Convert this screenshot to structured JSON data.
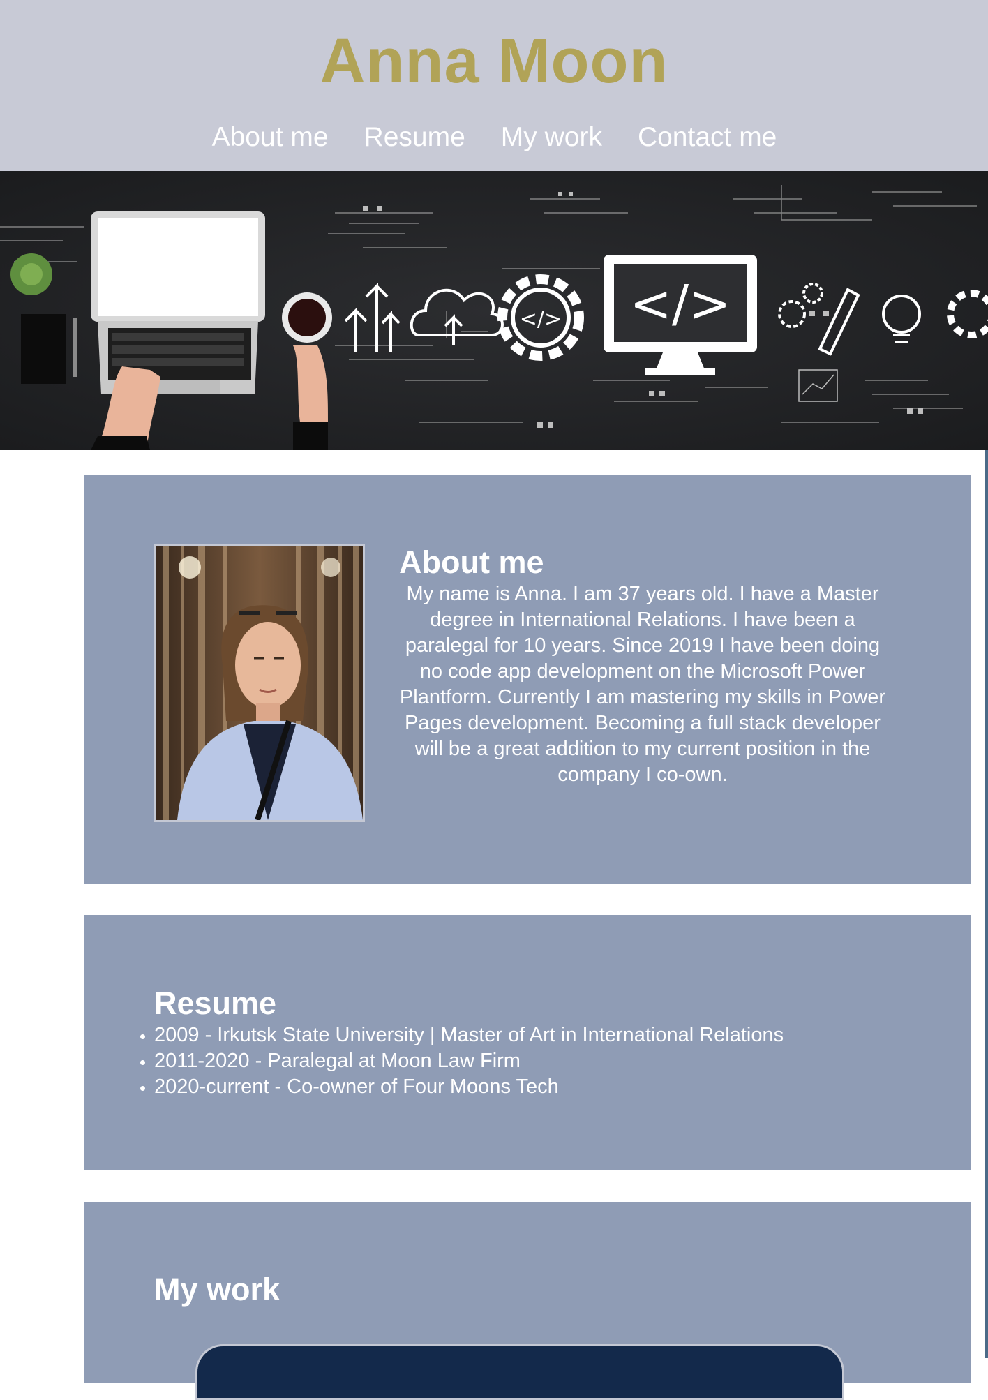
{
  "site": {
    "title": "Anna Moon",
    "colors": {
      "header_bg": "#c8cad6",
      "title": "#b1a357",
      "card_bg": "#8f9cb5",
      "text": "#ffffff"
    }
  },
  "nav": {
    "items": [
      {
        "label": "About me"
      },
      {
        "label": "Resume"
      },
      {
        "label": "My work"
      },
      {
        "label": "Contact me"
      }
    ]
  },
  "hero": {
    "alt_icon": "code-banner-image"
  },
  "about": {
    "heading": "About me",
    "text": "My name is Anna. I am 37 years old. I have a Master degree in International Relations. I have been a paralegal for 10 years. Since 2019 I have been doing no code app development on the Microsoft Power Plantform. Currently I am mastering my skills in Power Pages development. Becoming a full stack developer will be a great addition to my current position in the company I co-own."
  },
  "resume": {
    "heading": "Resume",
    "items": [
      "2009 - Irkutsk State University | Master of Art in International Relations",
      "2011-2020 - Paralegal at Moon Law Firm",
      "2020-current - Co-owner of Four Moons Tech"
    ]
  },
  "work": {
    "heading": "My work"
  }
}
